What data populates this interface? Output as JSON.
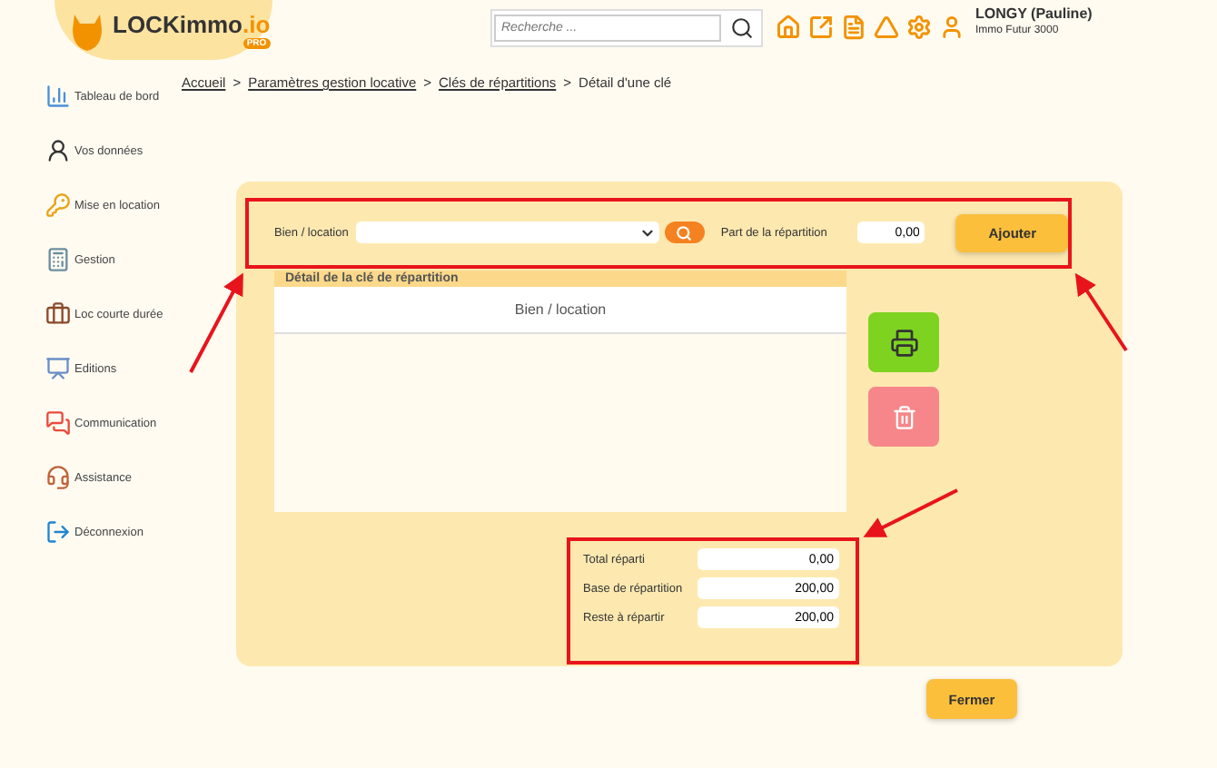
{
  "header": {
    "logo": {
      "name": "LOCKimmo",
      "suffix": ".io",
      "badge": "PRO"
    },
    "search": {
      "placeholder": "Recherche ..."
    },
    "user": {
      "name": "LONGY (Pauline)",
      "company": "Immo Futur 3000"
    }
  },
  "sidebar": {
    "items": [
      {
        "label": "Tableau de bord"
      },
      {
        "label": "Vos données"
      },
      {
        "label": "Mise en location"
      },
      {
        "label": "Gestion"
      },
      {
        "label": "Loc courte durée"
      },
      {
        "label": "Editions"
      },
      {
        "label": "Communication"
      },
      {
        "label": "Assistance"
      },
      {
        "label": "Déconnexion"
      }
    ]
  },
  "breadcrumb": [
    {
      "label": "Accueil",
      "kind": "link"
    },
    {
      "label": "Paramètres gestion locative",
      "kind": "link"
    },
    {
      "label": "Clés de répartitions",
      "kind": "link"
    },
    {
      "label": "Détail d'une clé",
      "kind": "current"
    }
  ],
  "breadcrumb_separator": ">",
  "form": {
    "property_label": "Bien / location",
    "share_label": "Part de la répartition",
    "share_value": "0,00",
    "add_button": "Ajouter"
  },
  "detail": {
    "title": "Détail de la clé de répartition",
    "columns": [
      "Bien / location"
    ]
  },
  "totals": [
    {
      "label": "Total réparti",
      "value": "0,00"
    },
    {
      "label": "Base de répartition",
      "value": "200,00"
    },
    {
      "label": "Reste à répartir",
      "value": "200,00"
    }
  ],
  "close_button": "Fermer"
}
